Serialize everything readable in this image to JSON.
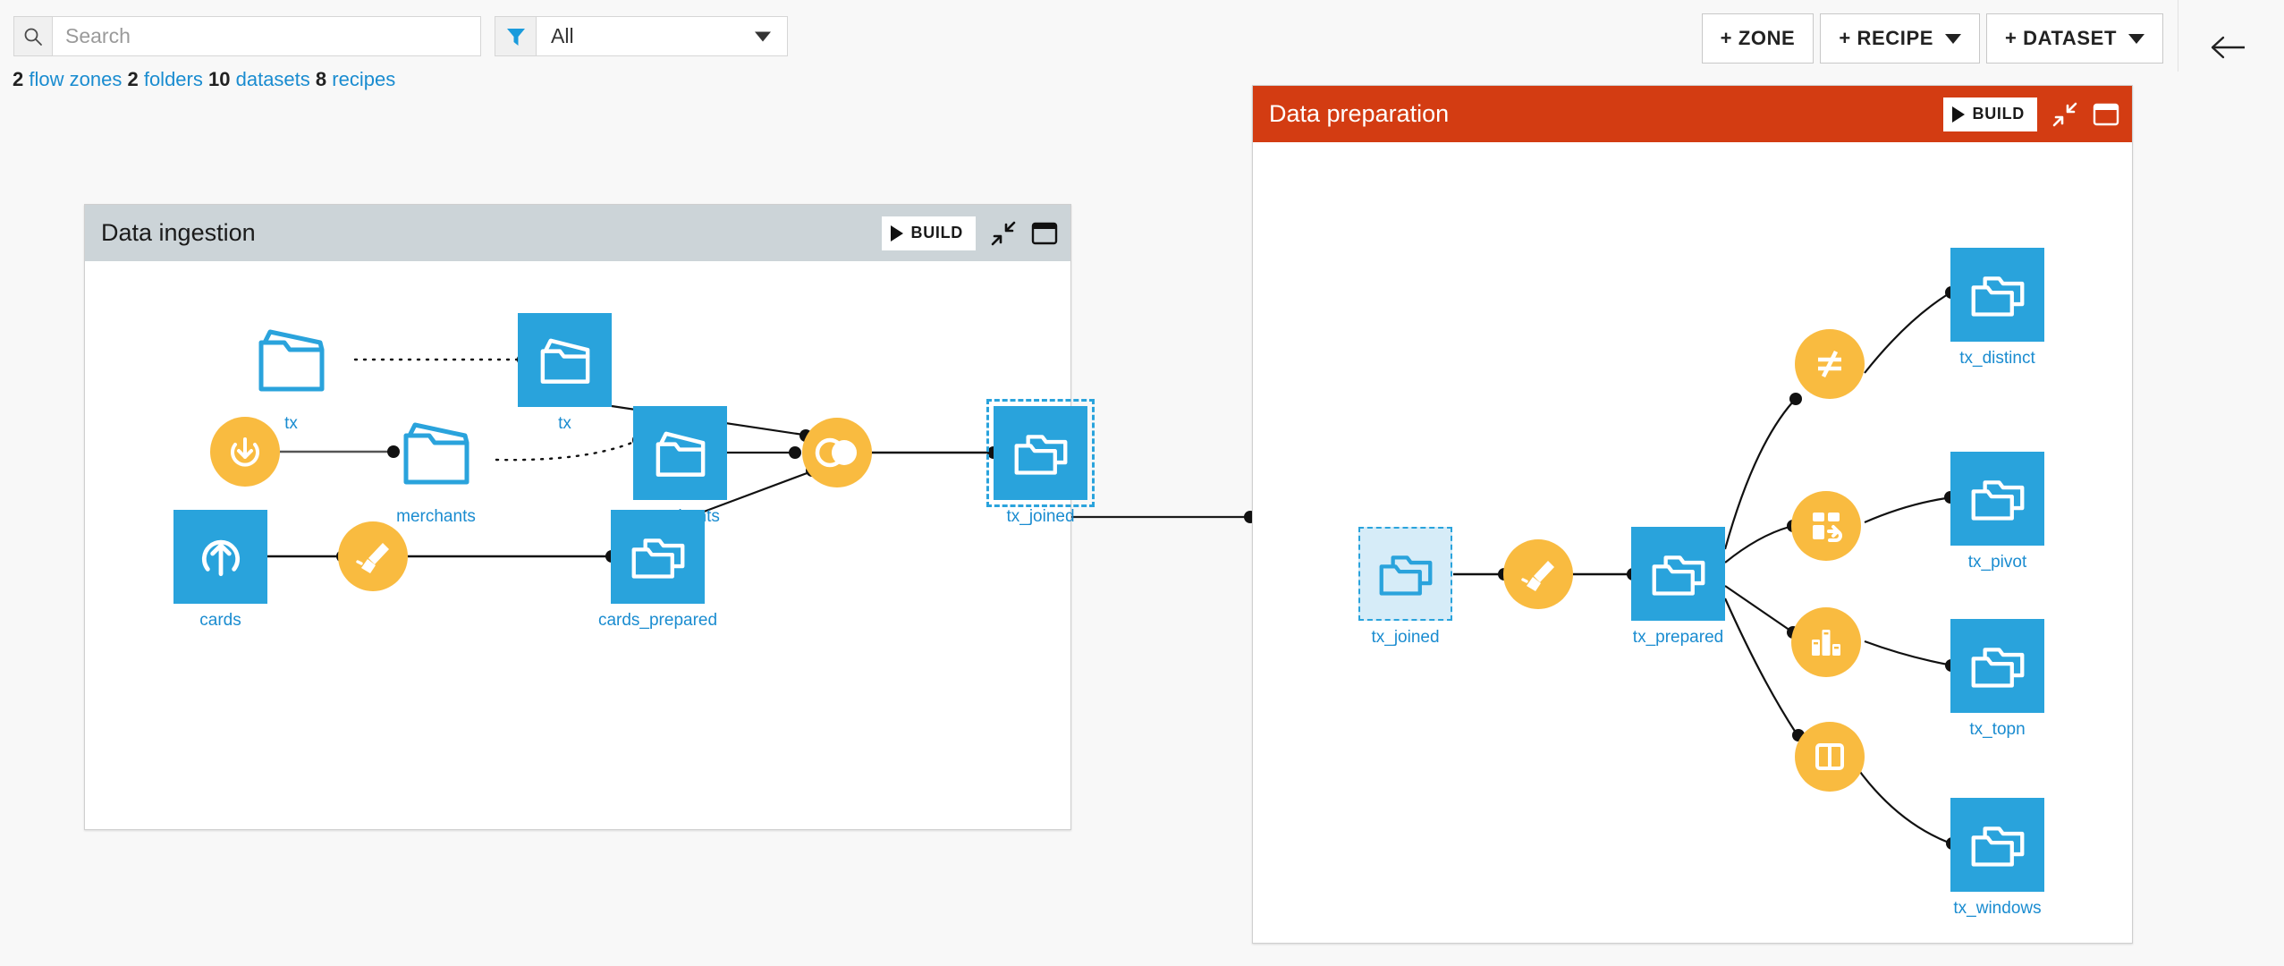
{
  "toolbar": {
    "search": {
      "placeholder": "Search",
      "value": "",
      "icon": "search-icon"
    },
    "filter": {
      "icon": "filter-icon",
      "selected": "All",
      "caret": "chevron-down-icon"
    },
    "buttons": [
      {
        "label": "+ ZONE",
        "has_caret": false,
        "name": "add-zone-button"
      },
      {
        "label": "+ RECIPE",
        "has_caret": true,
        "name": "add-recipe-button"
      },
      {
        "label": "+ DATASET",
        "has_caret": true,
        "name": "add-dataset-button"
      }
    ],
    "back_icon": "arrow-left-icon"
  },
  "stats": {
    "flow_zones_count": "2",
    "flow_zones_label": "flow zones",
    "folders_count": "2",
    "folders_label": "folders",
    "datasets_count": "10",
    "datasets_label": "datasets",
    "recipes_count": "8",
    "recipes_label": "recipes"
  },
  "colors": {
    "dataset_blue": "#29a3dc",
    "recipe_orange": "#f9bb40",
    "zone_preparation_header": "#d33c12",
    "zone_ingestion_header": "#ccd4d8",
    "link_blue": "#1a8cd0",
    "reference_fill": "#d6ecf8"
  },
  "zones": [
    {
      "id": "data-ingestion",
      "title": "Data ingestion",
      "build_label": "BUILD",
      "collapse_icon": "collapse-icon",
      "window_icon": "window-icon",
      "nodes": [
        {
          "id": "tx-source",
          "label": "tx",
          "kind": "source-folder",
          "icon": "folder-upload-icon"
        },
        {
          "id": "tx-dataset",
          "label": "tx",
          "kind": "dataset",
          "icon": "folder-upload-icon"
        },
        {
          "id": "sync-recipe",
          "label": "",
          "kind": "recipe",
          "icon": "download-recipe-icon"
        },
        {
          "id": "merchants-source",
          "label": "merchants",
          "kind": "source-folder",
          "icon": "folder-upload-icon"
        },
        {
          "id": "merchants-dataset",
          "label": "merchants",
          "kind": "dataset",
          "icon": "folder-upload-icon"
        },
        {
          "id": "cards-dataset",
          "label": "cards",
          "kind": "dataset",
          "icon": "upload-arrow-icon"
        },
        {
          "id": "prepare-recipe",
          "label": "",
          "kind": "recipe",
          "icon": "broom-recipe-icon"
        },
        {
          "id": "cards-prepared",
          "label": "cards_prepared",
          "kind": "dataset",
          "icon": "folders-icon"
        },
        {
          "id": "join-recipe",
          "label": "",
          "kind": "recipe",
          "icon": "join-recipe-icon"
        },
        {
          "id": "tx-joined",
          "label": "tx_joined",
          "kind": "dataset-selected",
          "icon": "folders-icon"
        }
      ]
    },
    {
      "id": "data-preparation",
      "title": "Data preparation",
      "build_label": "BUILD",
      "collapse_icon": "collapse-icon",
      "window_icon": "window-icon",
      "nodes": [
        {
          "id": "tx-joined-ref",
          "label": "tx_joined",
          "kind": "dataset-reference",
          "icon": "folders-icon"
        },
        {
          "id": "prepare-recipe2",
          "label": "",
          "kind": "recipe",
          "icon": "broom-recipe-icon"
        },
        {
          "id": "tx-prepared",
          "label": "tx_prepared",
          "kind": "dataset",
          "icon": "folders-icon"
        },
        {
          "id": "distinct-recipe",
          "label": "",
          "kind": "recipe",
          "icon": "distinct-recipe-icon"
        },
        {
          "id": "tx-distinct",
          "label": "tx_distinct",
          "kind": "dataset",
          "icon": "folders-icon"
        },
        {
          "id": "pivot-recipe",
          "label": "",
          "kind": "recipe",
          "icon": "pivot-recipe-icon"
        },
        {
          "id": "tx-pivot",
          "label": "tx_pivot",
          "kind": "dataset",
          "icon": "folders-icon"
        },
        {
          "id": "topn-recipe",
          "label": "",
          "kind": "recipe",
          "icon": "topn-recipe-icon"
        },
        {
          "id": "tx-topn",
          "label": "tx_topn",
          "kind": "dataset",
          "icon": "folders-icon"
        },
        {
          "id": "window-recipe",
          "label": "",
          "kind": "recipe",
          "icon": "window-recipe-icon"
        },
        {
          "id": "tx-windows",
          "label": "tx_windows",
          "kind": "dataset",
          "icon": "folders-icon"
        }
      ]
    }
  ]
}
